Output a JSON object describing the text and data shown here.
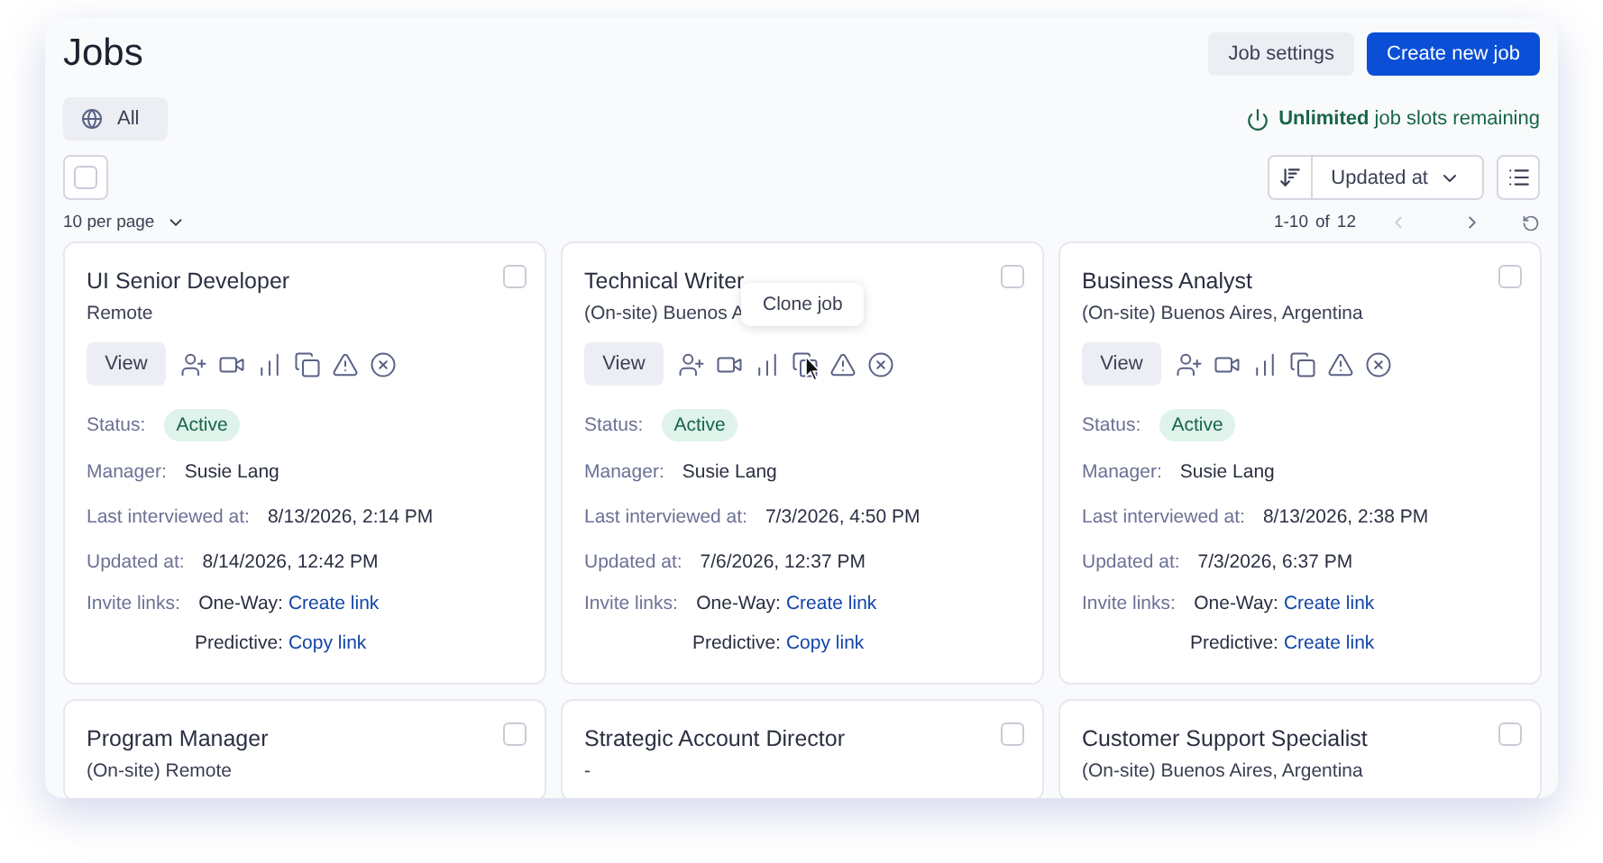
{
  "title": "Jobs",
  "header_buttons": [
    {
      "label": "Job settings",
      "kind": "secondary"
    },
    {
      "label": "Create new job",
      "kind": "primary"
    }
  ],
  "filter": {
    "label": "All"
  },
  "slots": "**Unlimited** job slots remaining",
  "select_all": {
    "checked": false
  },
  "sort": {
    "label": "Updated at"
  },
  "per_page": "10 per page",
  "pager": {
    "range": "1-10",
    "of": "of",
    "total": "12"
  },
  "cards": [
    {
      "title": "UI Senior Developer",
      "location": "Remote",
      "checked": false,
      "view": "View",
      "status_label": "Status:",
      "status": "Active",
      "details": [
        {
          "label": "Manager:",
          "value": "Susie Lang"
        },
        {
          "label": "Last interviewed at:",
          "value": "8/13/2026, 2:14 PM"
        },
        {
          "label": "Updated at:",
          "value": "8/14/2026, 12:42 PM"
        }
      ],
      "invite_label": "Invite links:",
      "invites": [
        {
          "label": "One-Way:",
          "link": "Create link"
        },
        {
          "label": "Predictive:",
          "link": "Copy link"
        }
      ]
    },
    {
      "title": "Technical Writer",
      "location": "(On-site) Buenos A",
      "checked": false,
      "view": "View",
      "tooltip": "Clone job",
      "status_label": "Status:",
      "status": "Active",
      "details": [
        {
          "label": "Manager:",
          "value": "Susie Lang"
        },
        {
          "label": "Last interviewed at:",
          "value": "7/3/2026, 4:50 PM"
        },
        {
          "label": "Updated at:",
          "value": "7/6/2026, 12:37 PM"
        }
      ],
      "invite_label": "Invite links:",
      "invites": [
        {
          "label": "One-Way:",
          "link": "Create link"
        },
        {
          "label": "Predictive:",
          "link": "Copy link"
        }
      ]
    },
    {
      "title": "Business Analyst",
      "location": "(On-site) Buenos Aires, Argentina",
      "checked": false,
      "view": "View",
      "status_label": "Status:",
      "status": "Active",
      "details": [
        {
          "label": "Manager:",
          "value": "Susie Lang"
        },
        {
          "label": "Last interviewed at:",
          "value": "8/13/2026, 2:38 PM"
        },
        {
          "label": "Updated at:",
          "value": "7/3/2026, 6:37 PM"
        }
      ],
      "invite_label": "Invite links:",
      "invites": [
        {
          "label": "One-Way:",
          "link": "Create link"
        },
        {
          "label": "Predictive:",
          "link": "Create link"
        }
      ]
    },
    {
      "title": "Program Manager",
      "location": "(On-site) Remote",
      "checked": false
    },
    {
      "title": "Strategic Account Director",
      "location": "-",
      "checked": false
    },
    {
      "title": "Customer Support Specialist",
      "location": "(On-site) Buenos Aires, Argentina",
      "checked": false
    }
  ]
}
